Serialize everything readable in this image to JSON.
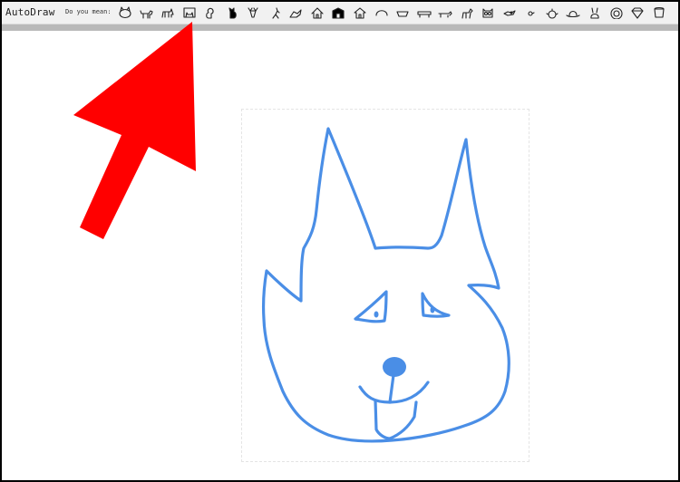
{
  "toolbar": {
    "app_title": "AutoDraw",
    "do_you_mean_label": "Do you mean:",
    "suggestions": [
      {
        "icon": "cat-face-icon"
      },
      {
        "icon": "dog-icon"
      },
      {
        "icon": "cat-icon"
      },
      {
        "icon": "cat-portrait-icon"
      },
      {
        "icon": "squirrel-icon"
      },
      {
        "icon": "black-cat-icon"
      },
      {
        "icon": "deer-icon"
      },
      {
        "icon": "kangaroo-icon"
      },
      {
        "icon": "fox-icon"
      },
      {
        "icon": "house-icon"
      },
      {
        "icon": "barn-icon"
      },
      {
        "icon": "cabin-icon"
      },
      {
        "icon": "rainbow-icon"
      },
      {
        "icon": "bowl-icon"
      },
      {
        "icon": "bench-icon"
      },
      {
        "icon": "dachshund-icon"
      },
      {
        "icon": "horse-icon"
      },
      {
        "icon": "owl-icon"
      },
      {
        "icon": "bird-icon"
      },
      {
        "icon": "small-bird-icon"
      },
      {
        "icon": "beetle-icon"
      },
      {
        "icon": "hat-icon"
      },
      {
        "icon": "rabbit-icon"
      },
      {
        "icon": "lion-icon"
      },
      {
        "icon": "diamond-icon"
      },
      {
        "icon": "cup-icon"
      }
    ]
  },
  "colors": {
    "stroke": "#4a8ee6",
    "arrow": "#ff0000",
    "toolbar_bg": "#f1f1f1",
    "scroll_track": "#b9b9b9"
  }
}
